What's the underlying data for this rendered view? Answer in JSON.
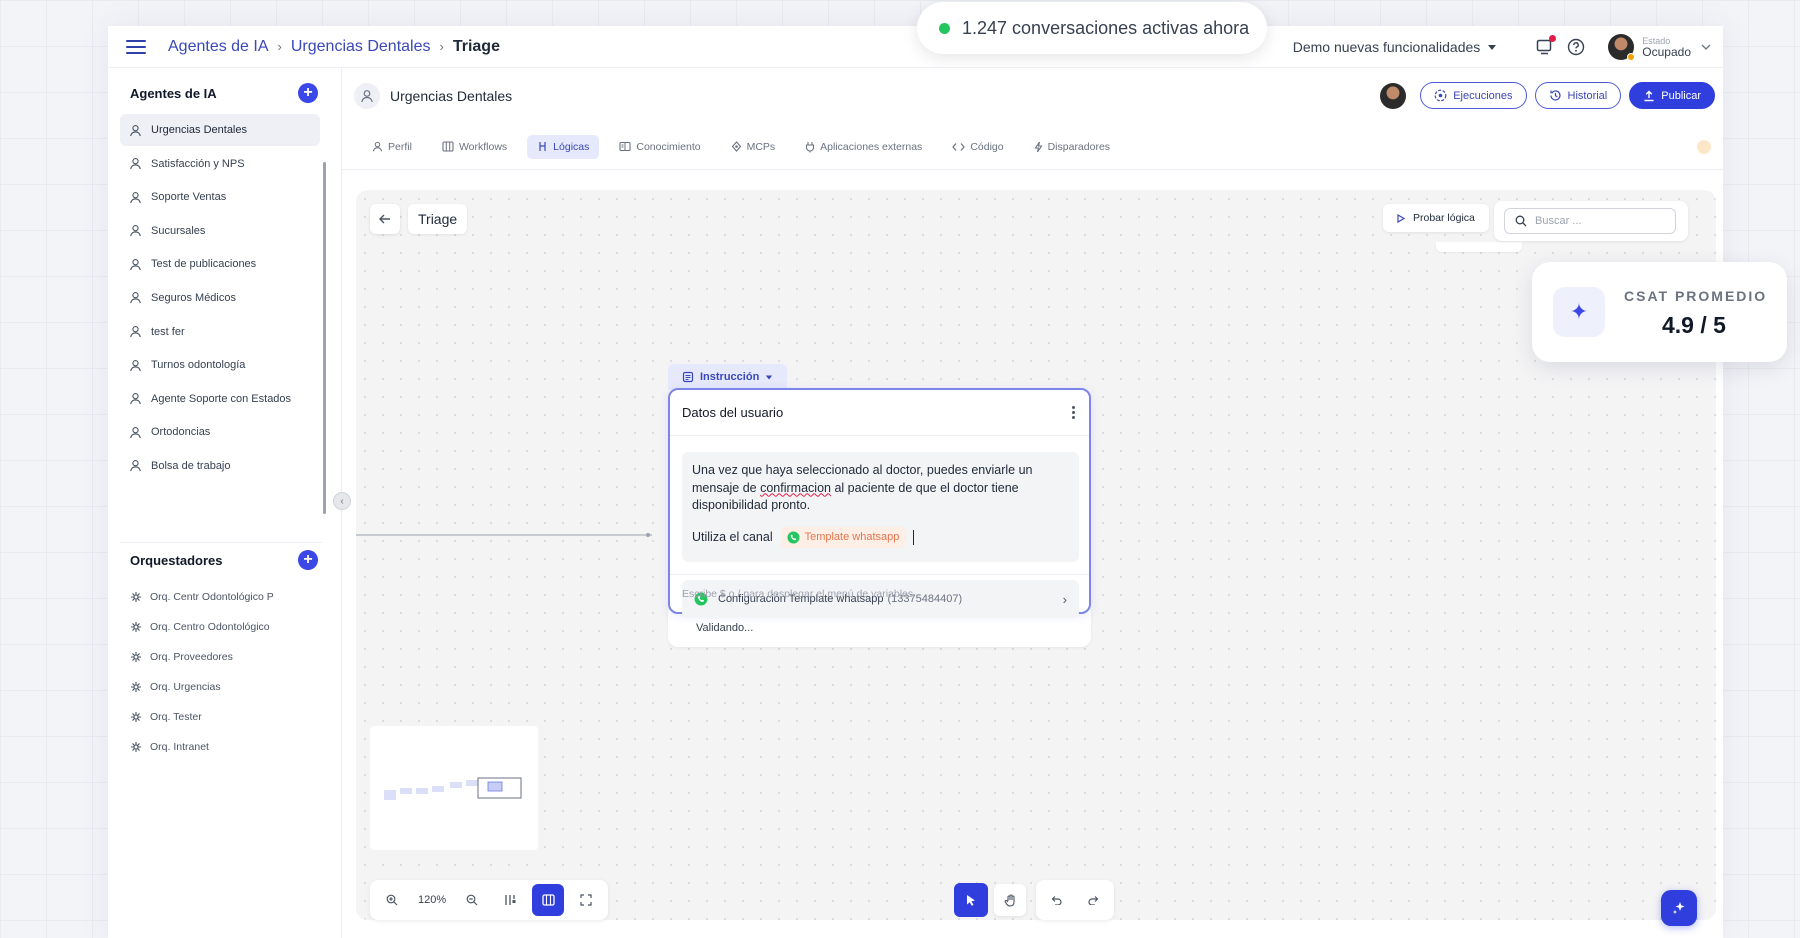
{
  "toast": {
    "text": "1.247 conversaciones activas ahora",
    "dot_color": "#22c55e"
  },
  "topbar": {
    "breadcrumb": [
      "Agentes de IA",
      "Urgencias Dentales",
      "Triage"
    ],
    "demo_select": "Demo nuevas funcionalidades",
    "estado_label": "Estado",
    "estado_value": "Ocupado"
  },
  "sidebar": {
    "agents_title": "Agentes de IA",
    "agents": [
      {
        "label": "Urgencias Dentales",
        "active": true
      },
      {
        "label": "Satisfacción y NPS"
      },
      {
        "label": "Soporte Ventas"
      },
      {
        "label": "Sucursales"
      },
      {
        "label": "Test de publicaciones"
      },
      {
        "label": "Seguros Médicos"
      },
      {
        "label": "test fer"
      },
      {
        "label": "Turnos odontología"
      },
      {
        "label": "Agente Soporte con Estados"
      },
      {
        "label": "Ortodoncias"
      },
      {
        "label": "Bolsa de trabajo"
      }
    ],
    "orq_title": "Orquestadores",
    "orquestadores": [
      {
        "label": "Orq. Centr Odontológico P"
      },
      {
        "label": "Orq. Centro Odontológico"
      },
      {
        "label": "Orq. Proveedores"
      },
      {
        "label": "Orq. Urgencias"
      },
      {
        "label": "Orq. Tester"
      },
      {
        "label": "Orq. Intranet"
      }
    ]
  },
  "agent_bar": {
    "name": "Urgencias Dentales",
    "ejecuciones": "Ejecuciones",
    "historial": "Historial",
    "publicar": "Publicar"
  },
  "tabs": [
    {
      "label": "Perfil",
      "icon": "user-icon"
    },
    {
      "label": "Workflows",
      "icon": "columns-icon"
    },
    {
      "label": "Lógicas",
      "icon": "logic-icon",
      "active": true
    },
    {
      "label": "Conocimiento",
      "icon": "book-icon"
    },
    {
      "label": "MCPs",
      "icon": "mcp-icon"
    },
    {
      "label": "Aplicaciones externas",
      "icon": "plug-icon"
    },
    {
      "label": "Código",
      "icon": "code-icon"
    },
    {
      "label": "Disparadores",
      "icon": "bolt-icon"
    }
  ],
  "canvas": {
    "title": "Triage",
    "probar": "Probar lógica",
    "search_placeholder": "Buscar ...",
    "zoom": "120%"
  },
  "node": {
    "type_tag": "Instrucción",
    "title": "Datos del usuario",
    "text_pre": "Una vez que haya seleccionado al doctor, puedes enviarle un mensaje de ",
    "text_misspelled": "confirmacion",
    "text_post": " al paciente de que el doctor tiene disponibilidad pronto.",
    "channel_text": "Utiliza el canal",
    "channel_chip": "Template whatsapp",
    "config_row": "Configuración Template whatsapp",
    "config_id": "(13375484407)",
    "footer_placeholder": "Escribe $ o / para desplegar el menú de variables",
    "status": "Validando..."
  },
  "csat": {
    "label": "CSAT PROMEDIO",
    "value": "4.9 / 5"
  },
  "colors": {
    "primary": "#2f3edc",
    "link": "#3a47b8",
    "whatsapp": "#22c55e"
  }
}
